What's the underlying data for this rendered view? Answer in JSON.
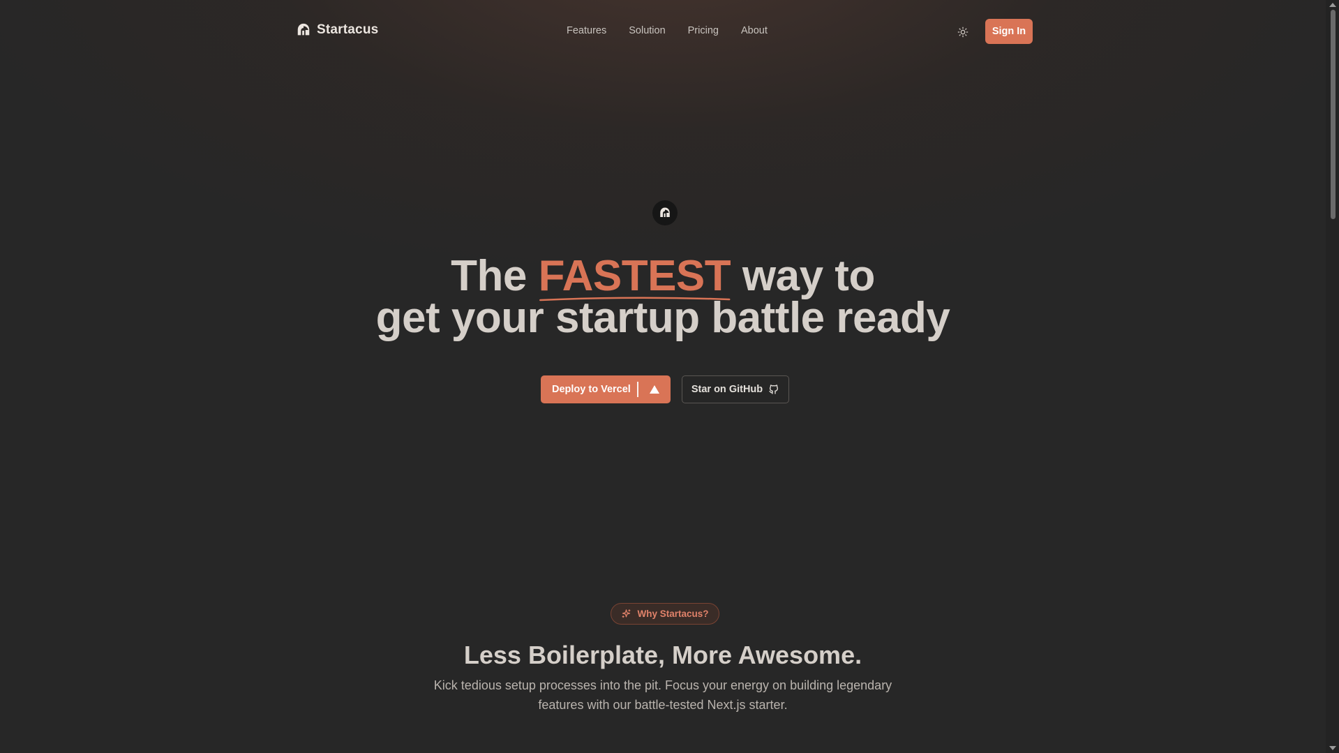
{
  "header": {
    "brand": "Startacus",
    "nav": [
      "Features",
      "Solution",
      "Pricing",
      "About"
    ],
    "sign_in": "Sign In",
    "theme_icon": "sun-icon"
  },
  "hero": {
    "title_the": "The",
    "title_accent": "FASTEST",
    "title_rest": "way to",
    "title_line2": "get your startup battle ready",
    "deploy_label": "Deploy to Vercel",
    "github_label": "Star on GitHub"
  },
  "section": {
    "pill_label": "Why Startacus?",
    "title": "Less Boilerplate, More Awesome.",
    "subtitle": "Kick tedious setup processes into the pit. Focus your energy on building legendary features with our battle-tested Next.js starter."
  },
  "colors": {
    "accent": "#d97456",
    "background": "#272727",
    "text": "#d5cfc9"
  }
}
